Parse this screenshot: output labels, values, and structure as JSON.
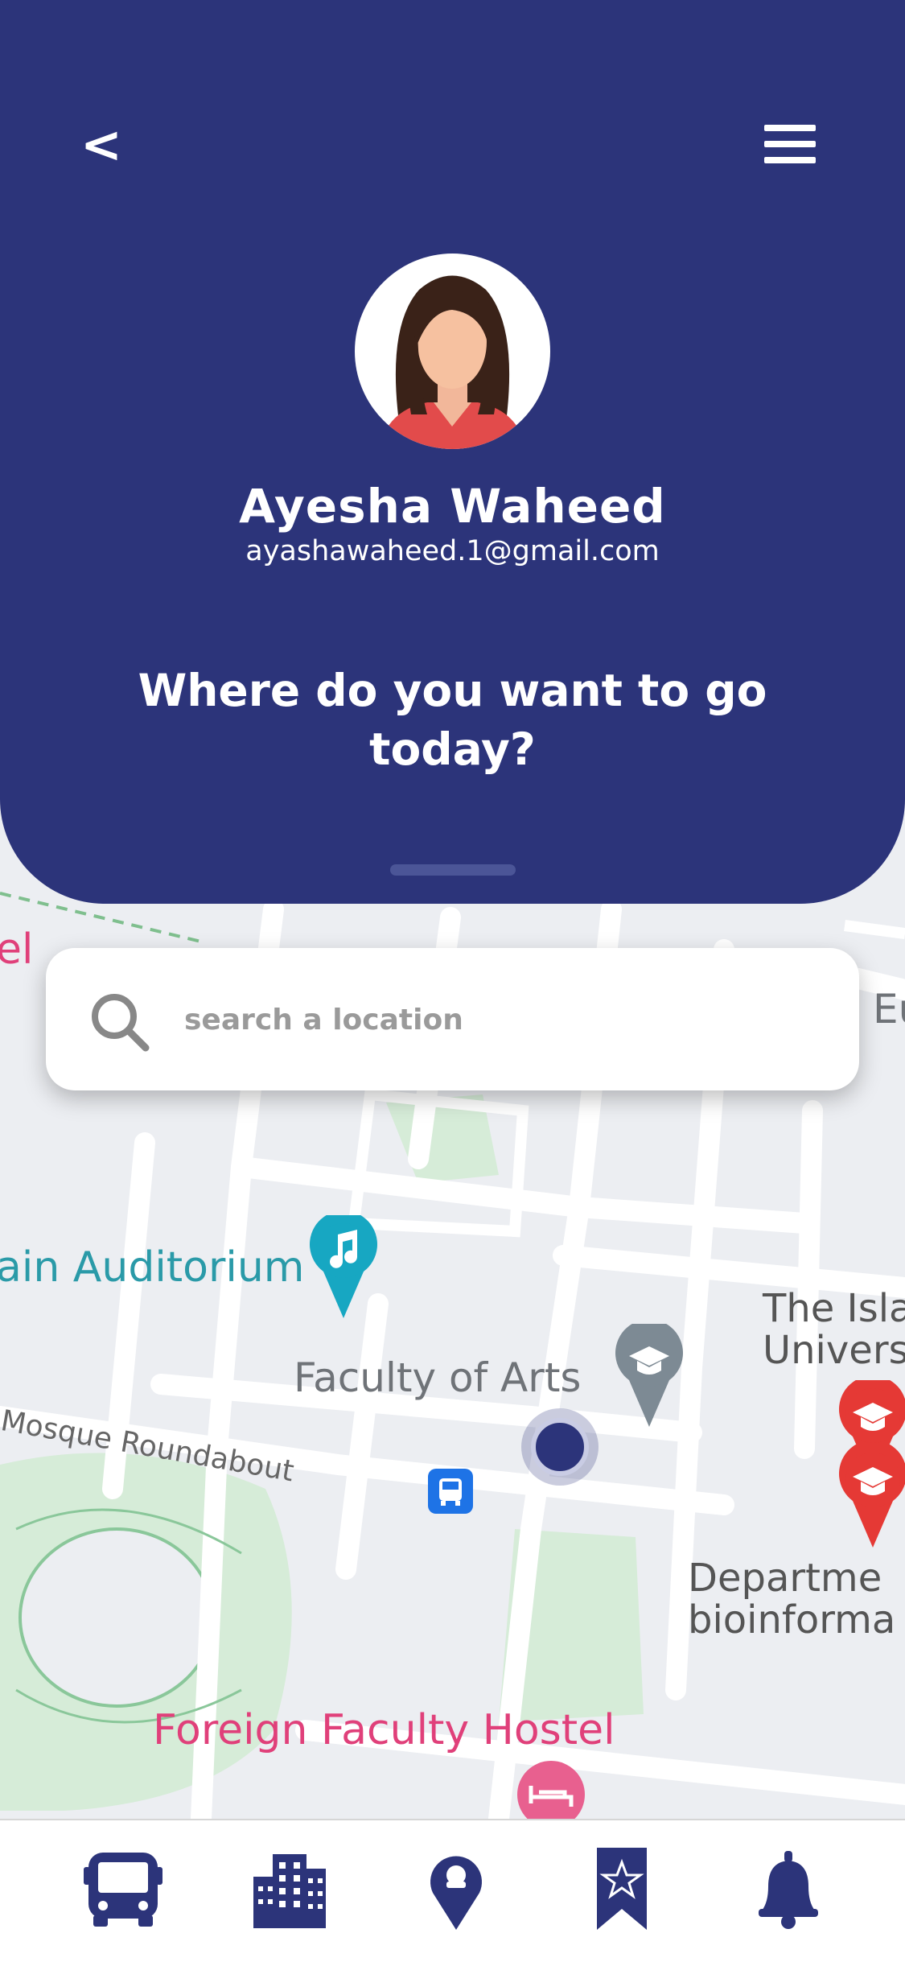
{
  "header": {
    "back_label": "<",
    "user_name": "Ayesha Waheed",
    "user_email": "ayashawaheed.1@gmail.com",
    "prompt": "Where do you want to go today?"
  },
  "search": {
    "placeholder": "search a location"
  },
  "map": {
    "labels": {
      "el_fragment": "el",
      "eu_fragment": "Eu",
      "auditorium": "ain Auditorium",
      "faculty_arts": "Faculty of Arts",
      "islamic_univ_line1": "The Isla",
      "islamic_univ_line2": "Univers",
      "mosque_roundabout": "Mosque Roundabout",
      "department_line1": "Departme",
      "department_line2": "bioinforma",
      "foreign_hostel": "Foreign Faculty Hostel"
    }
  },
  "bottom_nav": {
    "items": [
      "bus-icon",
      "building-icon",
      "location-pin-icon",
      "bookmark-star-icon",
      "bell-icon"
    ]
  },
  "colors": {
    "primary": "#2c347a",
    "map_bg": "#eceef2",
    "teal": "#2a9aa8",
    "pink": "#e0407a",
    "pin_red": "#e53935"
  }
}
